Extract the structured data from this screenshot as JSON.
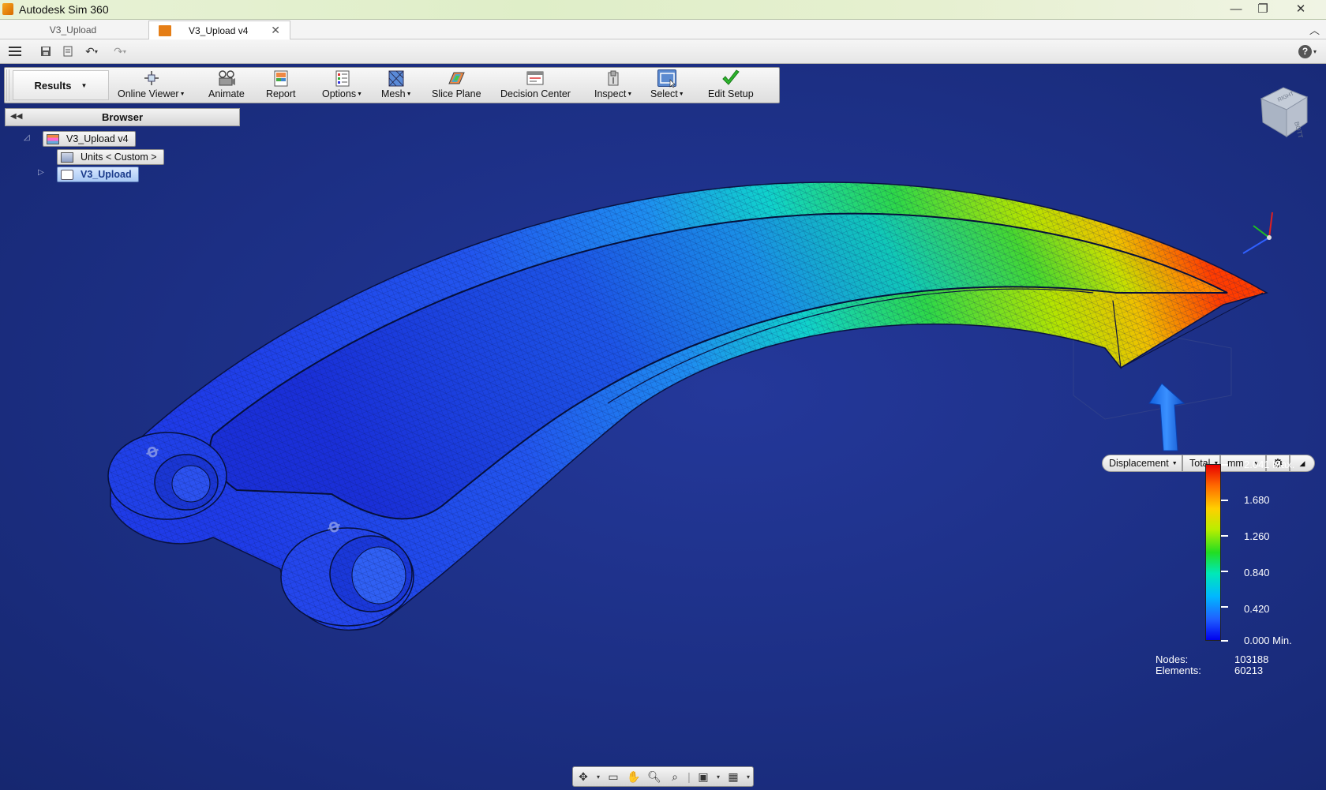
{
  "app": {
    "title": "Autodesk Sim 360"
  },
  "tabs": [
    {
      "label": "V3_Upload"
    },
    {
      "label": "V3_Upload v4"
    }
  ],
  "ribbon": {
    "active_tab": "Results",
    "buttons": [
      {
        "label": "Online Viewer",
        "dropdown": true,
        "icon": "online-viewer-icon"
      },
      {
        "label": "Animate",
        "dropdown": false,
        "icon": "animate-icon"
      },
      {
        "label": "Report",
        "dropdown": false,
        "icon": "report-icon"
      },
      {
        "label": "Options",
        "dropdown": true,
        "icon": "options-icon"
      },
      {
        "label": "Mesh",
        "dropdown": true,
        "icon": "mesh-icon"
      },
      {
        "label": "Slice Plane",
        "dropdown": false,
        "icon": "slice-plane-icon"
      },
      {
        "label": "Decision Center",
        "dropdown": false,
        "icon": "decision-center-icon"
      },
      {
        "label": "Inspect",
        "dropdown": true,
        "icon": "inspect-icon"
      },
      {
        "label": "Select",
        "dropdown": true,
        "icon": "select-icon"
      },
      {
        "label": "Edit Setup",
        "dropdown": false,
        "icon": "checkmark-icon"
      }
    ]
  },
  "browser": {
    "title": "Browser",
    "root": "V3_Upload v4",
    "units": "Units < Custom >",
    "part": "V3_Upload"
  },
  "legend": {
    "result": "Displacement",
    "component": "Total",
    "unit": "mm",
    "labels": [
      "2.041 Max.",
      "1.680",
      "1.260",
      "0.840",
      "0.420",
      "0.000 Min."
    ],
    "max_color": "#e80000",
    "min_color": "#0000ee"
  },
  "stats": {
    "nodes_label": "Nodes:",
    "nodes_value": "103188",
    "elements_label": "Elements:",
    "elements_value": "60213"
  }
}
